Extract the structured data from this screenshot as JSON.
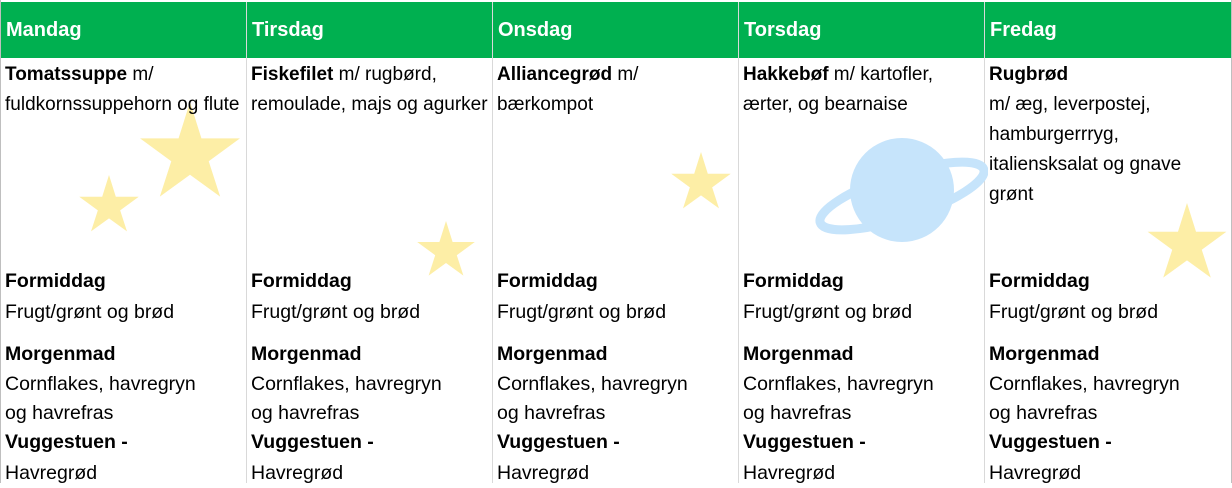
{
  "days": [
    {
      "name": "Mandag",
      "lunch_title": "Tomatssuppe",
      "lunch_desc": " m/ fuldkornssuppehorn og flute"
    },
    {
      "name": "Tirsdag",
      "lunch_title": "Fiskefilet",
      "lunch_desc": " m/ rugbørd, remoulade, majs og agurker"
    },
    {
      "name": "Onsdag",
      "lunch_title": "Alliancegrød",
      "lunch_desc": " m/ bærkompot"
    },
    {
      "name": "Torsdag",
      "lunch_title": "Hakkebøf",
      "lunch_desc": " m/ kartofler, ærter, og bearnaise"
    },
    {
      "name": "Fredag",
      "lunch_title": "Rugbrød",
      "lunch_desc": "m/ æg, leverpostej, hamburgerrryg, italiensksalat og gnave grønt"
    }
  ],
  "formiddag_title": "Formiddag",
  "formiddag_text": "Frugt/grønt og brød",
  "morgenmad_title": "Morgenmad",
  "morgenmad_line1": "Cornflakes, havregryn",
  "morgenmad_line2": "og havrefras",
  "vuggestuen_title": "Vuggestuen -",
  "vuggestuen_text": "Havregrød",
  "colors": {
    "header": "#00b050",
    "star": "#fdeea6",
    "planet": "#c6e4fb"
  }
}
